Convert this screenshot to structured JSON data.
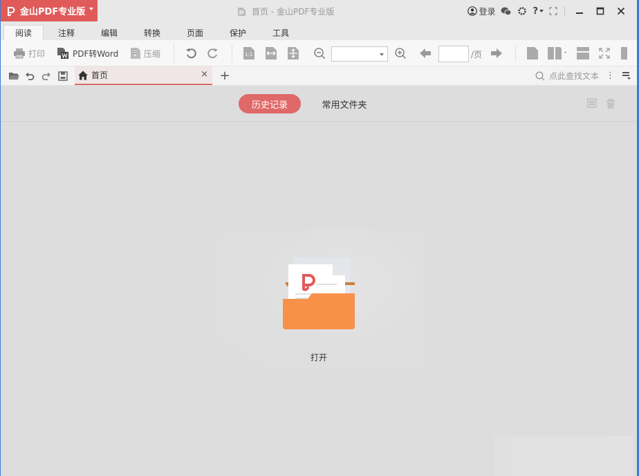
{
  "app": {
    "name": "金山PDF专业版",
    "window_title": "首页 - 金山PDF专业版",
    "accent_color": "#e05a5a"
  },
  "titlebar": {
    "login_label": "登录",
    "help_label": "?",
    "icons": [
      "user-icon",
      "wechat-icon",
      "gear-icon",
      "help-icon",
      "fullscreen-icon",
      "minimize-icon",
      "maximize-icon",
      "close-icon"
    ]
  },
  "menu": {
    "tabs": [
      "阅读",
      "注释",
      "编辑",
      "转换",
      "页面",
      "保护",
      "工具"
    ],
    "active": "阅读"
  },
  "toolbar": {
    "print_label": "打印",
    "pdf2word_label": "PDF转Word",
    "compress_label": "压缩",
    "zoom_value": "",
    "page_value": "",
    "page_suffix": "/页",
    "icons": [
      "rotate-left-icon",
      "rotate-right-icon",
      "actual-size-icon",
      "fit-width-icon",
      "fit-page-icon",
      "zoom-out-icon",
      "zoom-in-icon",
      "prev-page-icon",
      "next-page-icon",
      "single-page-icon",
      "double-page-icon",
      "continuous-icon",
      "fullscreen-icon"
    ]
  },
  "tabbar": {
    "doc_tab_label": "首页",
    "close_glyph": "×",
    "new_tab_glyph": "+",
    "search_placeholder": "点此查找文本",
    "more_glyph": "⋮"
  },
  "home": {
    "tabs": [
      "历史记录",
      "常用文件夹"
    ],
    "active_tab": "历史记录",
    "open_label": "打开"
  }
}
